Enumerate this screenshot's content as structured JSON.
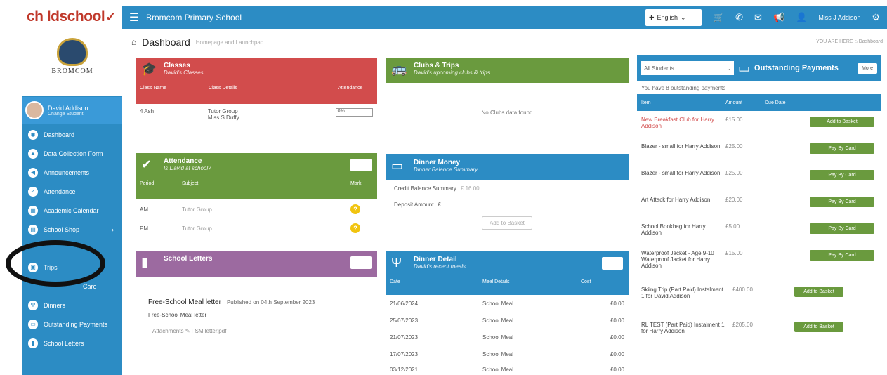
{
  "brand": {
    "logo_text": "ch ldschool",
    "logo_tick": "✓"
  },
  "navbar": {
    "school_name": "Bromcom Primary School",
    "language": "English",
    "user": "Miss J Addison"
  },
  "sidebar": {
    "school_label": "BROMCOM",
    "profile": {
      "name": "David Addison",
      "sub": "Change Student"
    },
    "items": [
      {
        "label": "Dashboard"
      },
      {
        "label": "Data Collection Form"
      },
      {
        "label": "Announcements"
      },
      {
        "label": "Attendance"
      },
      {
        "label": "Academic Calendar"
      },
      {
        "label": "School Shop"
      },
      {
        "label": ""
      },
      {
        "label": "Trips"
      },
      {
        "label": "Care"
      },
      {
        "label": "Dinners"
      },
      {
        "label": "Outstanding Payments"
      },
      {
        "label": "School Letters"
      }
    ]
  },
  "page": {
    "title": "Dashboard",
    "subtitle": "Homepage and Launchpad",
    "crumbs": "YOU ARE HERE  ⌂ Dashboard"
  },
  "classes": {
    "title": "Classes",
    "subtitle": "David's Classes",
    "headers": [
      "Class Name",
      "Class Details",
      "Attendance"
    ],
    "row": {
      "name": "4 Ash",
      "details1": "Tutor Group",
      "details2": "Miss S Duffy",
      "attendance": "0%"
    }
  },
  "clubs": {
    "title": "Clubs & Trips",
    "subtitle": "David's upcoming clubs & trips",
    "empty": "No Clubs data found"
  },
  "attendance": {
    "title": "Attendance",
    "subtitle": "Is David at school?",
    "headers": [
      "Period",
      "Subject",
      "Mark"
    ],
    "rows": [
      {
        "period": "AM",
        "subject": "Tutor Group",
        "mark": "?"
      },
      {
        "period": "PM",
        "subject": "Tutor Group",
        "mark": "?"
      }
    ]
  },
  "dinner_money": {
    "title": "Dinner Money",
    "subtitle": "Dinner Balance Summary",
    "credit_label": "Credit Balance Summary",
    "credit_value": "£ 16.00",
    "deposit_label": "Deposit Amount",
    "deposit_value": "£",
    "add_button": "Add to Basket"
  },
  "letters": {
    "title": "School Letters",
    "letter_title": "Free-School Meal letter",
    "published": "Published on 04th September 2023",
    "body": "Free-School Meal letter",
    "attachments_label": "Attachments",
    "attachment_file": "✎ FSM letter.pdf"
  },
  "dinner_detail": {
    "title": "Dinner Detail",
    "subtitle": "David's recent meals",
    "headers": [
      "Date",
      "Meal Details",
      "Cost"
    ],
    "rows": [
      {
        "date": "21/06/2024",
        "meal": "School Meal",
        "cost": "£0.00"
      },
      {
        "date": "25/07/2023",
        "meal": "School Meal",
        "cost": "£0.00"
      },
      {
        "date": "21/07/2023",
        "meal": "School Meal",
        "cost": "£0.00"
      },
      {
        "date": "17/07/2023",
        "meal": "School Meal",
        "cost": "£0.00"
      },
      {
        "date": "03/12/2021",
        "meal": "School Meal",
        "cost": "£0.00"
      }
    ]
  },
  "payments": {
    "student_select": "All Students",
    "title": "Outstanding Payments",
    "more": "More",
    "summary": "You have 8 outstanding payments",
    "headers": [
      "Item",
      "Amount",
      "Due Date"
    ],
    "rows": [
      {
        "item": "New Breakfast Club for Harry Addison",
        "amount": "£15.00",
        "action": "Add to Basket",
        "highlight": true
      },
      {
        "item": "Blazer - small for Harry Addison",
        "amount": "£25.00",
        "action": "Pay By Card"
      },
      {
        "item": "Blazer - small for Harry Addison",
        "amount": "£25.00",
        "action": "Pay By Card"
      },
      {
        "item": "Art Attack for Harry Addison",
        "amount": "£20.00",
        "action": "Pay By Card"
      },
      {
        "item": "School Bookbag for Harry Addison",
        "amount": "£5.00",
        "action": "Pay By Card"
      },
      {
        "item": "Waterproof Jacket - Age 9-10 Waterproof Jacket for Harry Addison",
        "amount": "£15.00",
        "action": "Pay By Card"
      },
      {
        "item": "Skiing Trip (Part Paid) Instalment 1 for David Addison",
        "amount": "£400.00",
        "action": "Add to Basket"
      },
      {
        "item": "RL TEST (Part Paid) Instalment 1 for Harry Addison",
        "amount": "£205.00",
        "action": "Add to Basket"
      }
    ]
  }
}
